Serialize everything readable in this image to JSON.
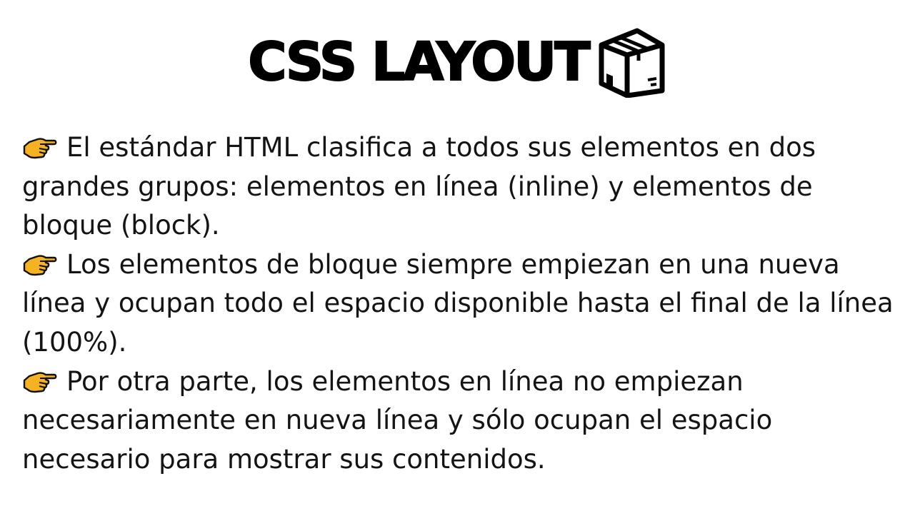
{
  "title": "CSS LAYOUT",
  "title_icon": "package-box-icon",
  "bullet_icon": "pointing-hand-icon",
  "colors": {
    "text": "#141414",
    "hand_fill": "#F5B324",
    "hand_outline": "#111111"
  },
  "paragraphs": [
    {
      "text": "El estándar HTML clasifica a todos sus elementos en dos grandes grupos: elementos en línea (inline) y elementos de bloque (block)."
    },
    {
      "text": "Los elementos de bloque siempre empiezan en una nueva línea y ocupan todo el espacio disponible hasta el final de la línea (100%)."
    },
    {
      "text": "Por otra parte, los elementos en línea no empiezan necesariamente en nueva línea y sólo ocupan el espacio necesario para mostrar sus contenidos."
    }
  ]
}
